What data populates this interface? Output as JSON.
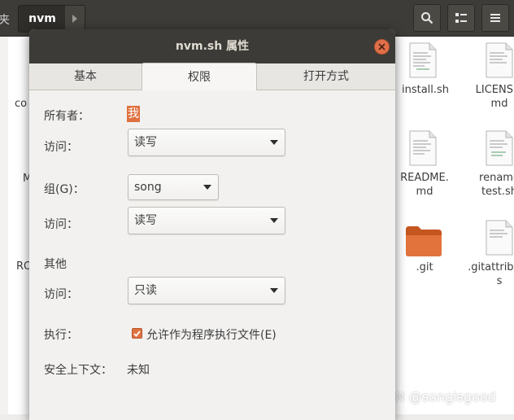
{
  "file_manager": {
    "left_crumb": "夹",
    "current_folder": "nvm",
    "files": [
      {
        "name": "install.sh"
      },
      {
        "name": "LICENSE.md"
      },
      {
        "name": "README.md"
      },
      {
        "name": "rename test.sh"
      },
      {
        "name": ".git"
      },
      {
        "name": ".gitattributes"
      }
    ],
    "left_labels": [
      "co",
      "M",
      "RO"
    ]
  },
  "dialog": {
    "title": "nvm.sh 属性",
    "tabs": [
      {
        "label": "基本",
        "active": false
      },
      {
        "label": "权限",
        "active": true
      },
      {
        "label": "打开方式",
        "active": false
      }
    ],
    "owner": {
      "label": "所有者：",
      "value": "我"
    },
    "owner_access": {
      "label": "访问：",
      "value": "读写"
    },
    "group": {
      "label": "组(G)：",
      "value": "song"
    },
    "group_access": {
      "label": "访问：",
      "value": "读写"
    },
    "others": {
      "section": "其他",
      "label": "访问：",
      "value": "只读"
    },
    "execute": {
      "label": "执行：",
      "checkbox_label": "允许作为程序执行文件(E)",
      "checked": true
    },
    "security_context": {
      "label": "安全上下文：",
      "value": "未知"
    }
  },
  "watermark": "CSDN @songisgood",
  "colors": {
    "accent": "#e0703f",
    "titlebar": "#3c3b37",
    "dialog_bg": "#f2f1f0"
  }
}
